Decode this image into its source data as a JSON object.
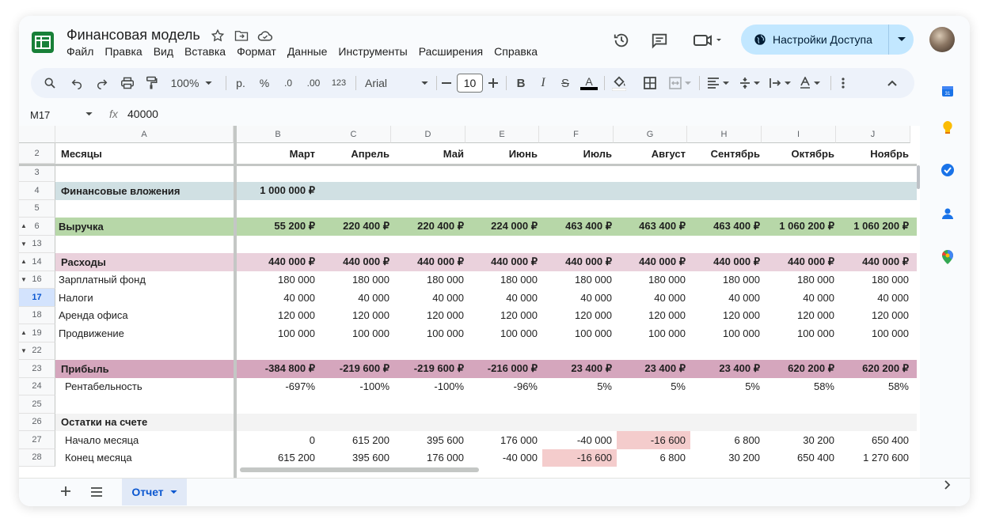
{
  "doc": {
    "title": "Финансовая модель",
    "menu": [
      "Файл",
      "Правка",
      "Вид",
      "Вставка",
      "Формат",
      "Данные",
      "Инструменты",
      "Расширения",
      "Справка"
    ]
  },
  "share": {
    "label": "Настройки Доступа"
  },
  "toolbar": {
    "zoom": "100%",
    "currency": "р.",
    "percent": "%",
    "dec_decrease": ".0",
    "dec_increase": ".00",
    "format_123": "123",
    "font": "Arial",
    "font_size": "10"
  },
  "formula_bar": {
    "cell_ref": "M17",
    "fx": "fx",
    "value": "40000"
  },
  "columns": [
    "A",
    "B",
    "C",
    "D",
    "E",
    "F",
    "G",
    "H",
    "I",
    "J"
  ],
  "rows": [
    {
      "num": "2",
      "kind": "header",
      "label": "Месяцы",
      "values": [
        "Март",
        "Апрель",
        "Май",
        "Июнь",
        "Июль",
        "Август",
        "Сентябрь",
        "Октябрь",
        "Ноябрь"
      ]
    },
    {
      "num": "3",
      "kind": "blank",
      "label": "",
      "values": []
    },
    {
      "num": "4",
      "kind": "invest",
      "label": "Финансовые вложения",
      "values": [
        "1 000 000 ₽",
        "",
        "",
        "",
        "",
        "",
        "",
        "",
        ""
      ]
    },
    {
      "num": "5",
      "kind": "blank",
      "label": "",
      "values": []
    },
    {
      "num": "6",
      "kind": "revenue",
      "ctl": "▲",
      "label": "Выручка",
      "values": [
        "55 200 ₽",
        "220 400 ₽",
        "220 400 ₽",
        "224 000 ₽",
        "463 400 ₽",
        "463 400 ₽",
        "463 400 ₽",
        "1 060 200 ₽",
        "1 060 200 ₽"
      ]
    },
    {
      "num": "13",
      "kind": "blank",
      "ctl": "▼",
      "label": "",
      "values": []
    },
    {
      "num": "14",
      "kind": "expenses",
      "ctl": "▲",
      "label": "Расходы",
      "values": [
        "440 000 ₽",
        "440 000 ₽",
        "440 000 ₽",
        "440 000 ₽",
        "440 000 ₽",
        "440 000 ₽",
        "440 000 ₽",
        "440 000 ₽",
        "440 000 ₽"
      ]
    },
    {
      "num": "16",
      "kind": "plain",
      "ctl": "▼",
      "label": "Зарплатный фонд",
      "values": [
        "180 000",
        "180 000",
        "180 000",
        "180 000",
        "180 000",
        "180 000",
        "180 000",
        "180 000",
        "180 000"
      ]
    },
    {
      "num": "17",
      "kind": "plain",
      "sel": true,
      "label": "Налоги",
      "values": [
        "40 000",
        "40 000",
        "40 000",
        "40 000",
        "40 000",
        "40 000",
        "40 000",
        "40 000",
        "40 000"
      ]
    },
    {
      "num": "18",
      "kind": "plain",
      "label": "Аренда офиса",
      "values": [
        "120 000",
        "120 000",
        "120 000",
        "120 000",
        "120 000",
        "120 000",
        "120 000",
        "120 000",
        "120 000"
      ]
    },
    {
      "num": "19",
      "kind": "plain",
      "ctl": "▲",
      "label": "Продвижение",
      "values": [
        "100 000",
        "100 000",
        "100 000",
        "100 000",
        "100 000",
        "100 000",
        "100 000",
        "100 000",
        "100 000"
      ]
    },
    {
      "num": "22",
      "kind": "blank",
      "ctl": "▼",
      "label": "",
      "values": []
    },
    {
      "num": "23",
      "kind": "profit",
      "label": "Прибыль",
      "values": [
        "-384 800 ₽",
        "-219 600 ₽",
        "-219 600 ₽",
        "-216 000 ₽",
        "23 400 ₽",
        "23 400 ₽",
        "23 400 ₽",
        "620 200 ₽",
        "620 200 ₽"
      ]
    },
    {
      "num": "24",
      "kind": "indent",
      "label": "Рентабельность",
      "values": [
        "-697%",
        "-100%",
        "-100%",
        "-96%",
        "5%",
        "5%",
        "5%",
        "58%",
        "58%"
      ]
    },
    {
      "num": "25",
      "kind": "blank",
      "label": "",
      "values": []
    },
    {
      "num": "26",
      "kind": "balance",
      "label": "Остатки на счете",
      "values": [
        "",
        "",
        "",
        "",
        "",
        "",
        "",
        "",
        ""
      ]
    },
    {
      "num": "27",
      "kind": "indent",
      "label": "Начало месяца",
      "values": [
        "0",
        "615 200",
        "395 600",
        "176 000",
        "-40 000",
        "-16 600",
        "6 800",
        "30 200",
        "650 400"
      ],
      "neg": [
        5
      ]
    },
    {
      "num": "28",
      "kind": "indent",
      "label": "Конец месяца",
      "values": [
        "615 200",
        "395 600",
        "176 000",
        "-40 000",
        "-16 600",
        "6 800",
        "30 200",
        "650 400",
        "1 270 600"
      ],
      "neg": [
        4
      ]
    }
  ],
  "colors": {
    "invest": "#d0e0e3",
    "revenue": "#b7d7a8",
    "expenses": "#ead1dc",
    "profit": "#d5a6bd",
    "balance": "#f3f3f3",
    "negative": "#f4cccc",
    "share_button": "#c2e7ff"
  },
  "sheets": [
    {
      "label": "Отчет",
      "active": true
    }
  ]
}
